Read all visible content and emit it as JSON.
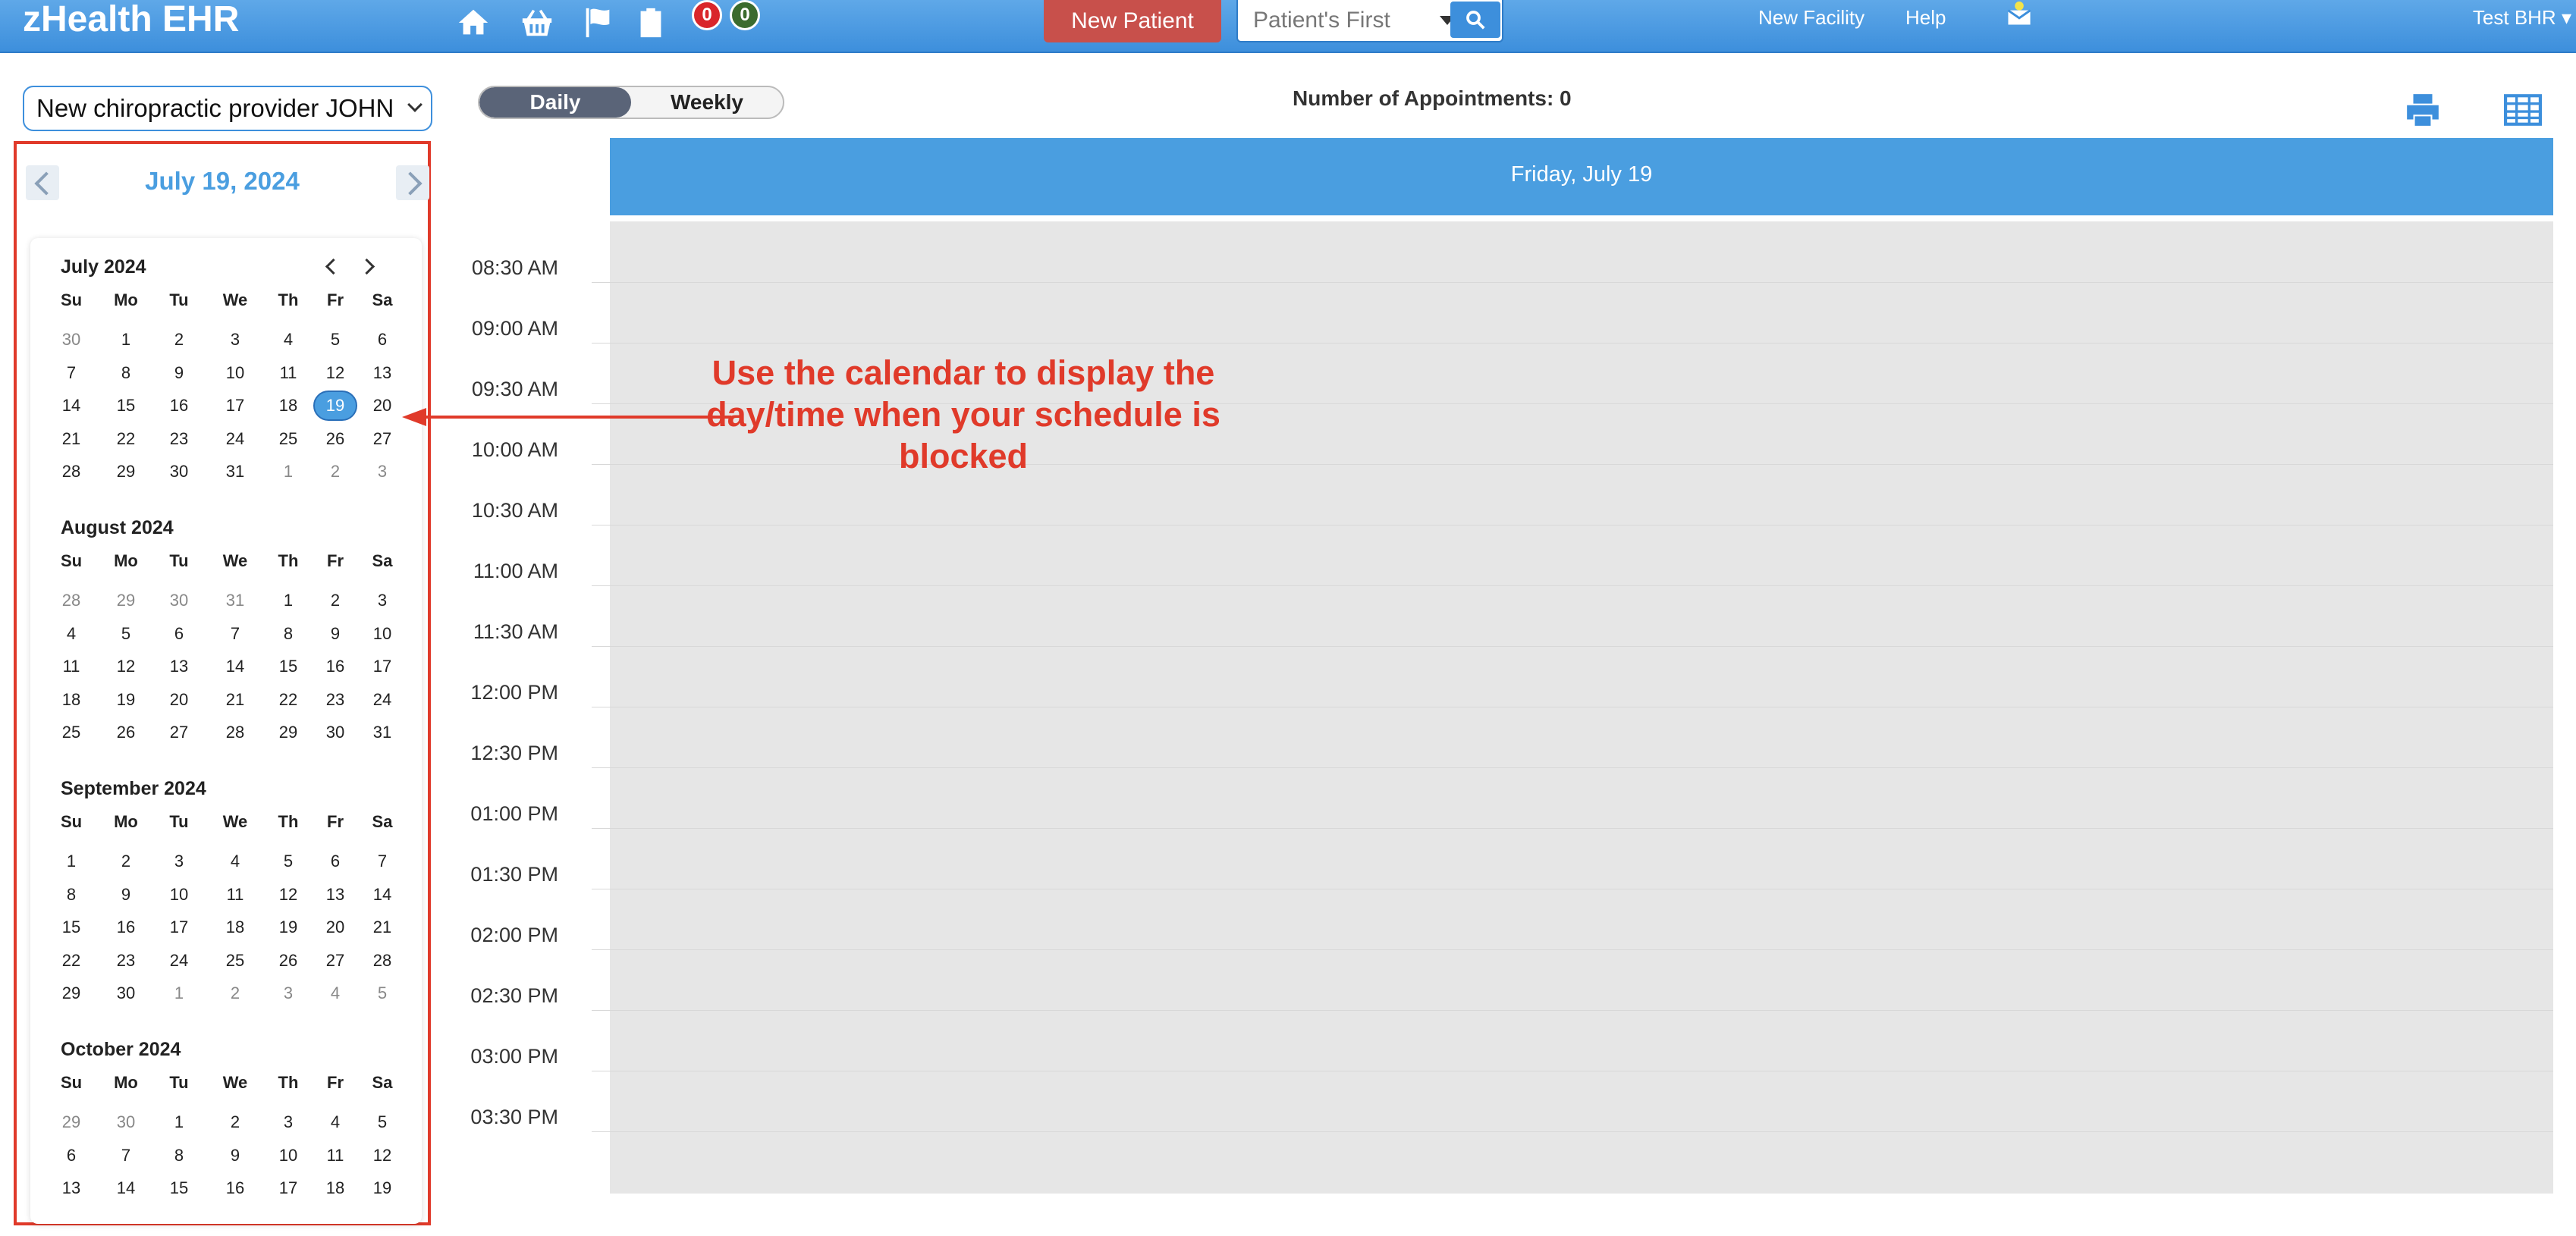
{
  "topbar": {
    "brand": "zHealth EHR",
    "badges": [
      {
        "count": "0",
        "color": "#d9262b"
      },
      {
        "count": "0",
        "color": "#3b6b2e"
      }
    ],
    "new_patient_label": "New Patient",
    "search_placeholder": "Patient's First",
    "links": {
      "new_facility": "New Facility",
      "help": "Help"
    },
    "user": "Test BHR"
  },
  "provider": {
    "selected": "New chiropractic provider JOHN SMITH"
  },
  "calendar": {
    "current_date": "July 19, 2024",
    "weekday_headers": [
      "Su",
      "Mo",
      "Tu",
      "We",
      "Th",
      "Fr",
      "Sa"
    ],
    "months": [
      {
        "title": "July 2024",
        "weeks": [
          [
            {
              "d": "30",
              "o": true
            },
            {
              "d": "1"
            },
            {
              "d": "2"
            },
            {
              "d": "3"
            },
            {
              "d": "4"
            },
            {
              "d": "5"
            },
            {
              "d": "6"
            }
          ],
          [
            {
              "d": "7"
            },
            {
              "d": "8"
            },
            {
              "d": "9"
            },
            {
              "d": "10"
            },
            {
              "d": "11"
            },
            {
              "d": "12"
            },
            {
              "d": "13"
            }
          ],
          [
            {
              "d": "14"
            },
            {
              "d": "15"
            },
            {
              "d": "16"
            },
            {
              "d": "17"
            },
            {
              "d": "18"
            },
            {
              "d": "19",
              "s": true
            },
            {
              "d": "20"
            }
          ],
          [
            {
              "d": "21"
            },
            {
              "d": "22"
            },
            {
              "d": "23"
            },
            {
              "d": "24"
            },
            {
              "d": "25"
            },
            {
              "d": "26"
            },
            {
              "d": "27"
            }
          ],
          [
            {
              "d": "28"
            },
            {
              "d": "29"
            },
            {
              "d": "30"
            },
            {
              "d": "31"
            },
            {
              "d": "1",
              "o": true
            },
            {
              "d": "2",
              "o": true
            },
            {
              "d": "3",
              "o": true
            }
          ]
        ]
      },
      {
        "title": "August 2024",
        "weeks": [
          [
            {
              "d": "28",
              "o": true
            },
            {
              "d": "29",
              "o": true
            },
            {
              "d": "30",
              "o": true
            },
            {
              "d": "31",
              "o": true
            },
            {
              "d": "1"
            },
            {
              "d": "2"
            },
            {
              "d": "3"
            }
          ],
          [
            {
              "d": "4"
            },
            {
              "d": "5"
            },
            {
              "d": "6"
            },
            {
              "d": "7"
            },
            {
              "d": "8"
            },
            {
              "d": "9"
            },
            {
              "d": "10"
            }
          ],
          [
            {
              "d": "11"
            },
            {
              "d": "12"
            },
            {
              "d": "13"
            },
            {
              "d": "14"
            },
            {
              "d": "15"
            },
            {
              "d": "16"
            },
            {
              "d": "17"
            }
          ],
          [
            {
              "d": "18"
            },
            {
              "d": "19"
            },
            {
              "d": "20"
            },
            {
              "d": "21"
            },
            {
              "d": "22"
            },
            {
              "d": "23"
            },
            {
              "d": "24"
            }
          ],
          [
            {
              "d": "25"
            },
            {
              "d": "26"
            },
            {
              "d": "27"
            },
            {
              "d": "28"
            },
            {
              "d": "29"
            },
            {
              "d": "30"
            },
            {
              "d": "31"
            }
          ]
        ]
      },
      {
        "title": "September 2024",
        "weeks": [
          [
            {
              "d": "1"
            },
            {
              "d": "2"
            },
            {
              "d": "3"
            },
            {
              "d": "4"
            },
            {
              "d": "5"
            },
            {
              "d": "6"
            },
            {
              "d": "7"
            }
          ],
          [
            {
              "d": "8"
            },
            {
              "d": "9"
            },
            {
              "d": "10"
            },
            {
              "d": "11"
            },
            {
              "d": "12"
            },
            {
              "d": "13"
            },
            {
              "d": "14"
            }
          ],
          [
            {
              "d": "15"
            },
            {
              "d": "16"
            },
            {
              "d": "17"
            },
            {
              "d": "18"
            },
            {
              "d": "19"
            },
            {
              "d": "20"
            },
            {
              "d": "21"
            }
          ],
          [
            {
              "d": "22"
            },
            {
              "d": "23"
            },
            {
              "d": "24"
            },
            {
              "d": "25"
            },
            {
              "d": "26"
            },
            {
              "d": "27"
            },
            {
              "d": "28"
            }
          ],
          [
            {
              "d": "29"
            },
            {
              "d": "30"
            },
            {
              "d": "1",
              "o": true
            },
            {
              "d": "2",
              "o": true
            },
            {
              "d": "3",
              "o": true
            },
            {
              "d": "4",
              "o": true
            },
            {
              "d": "5",
              "o": true
            }
          ]
        ]
      },
      {
        "title": "October 2024",
        "weeks": [
          [
            {
              "d": "29",
              "o": true
            },
            {
              "d": "30",
              "o": true
            },
            {
              "d": "1"
            },
            {
              "d": "2"
            },
            {
              "d": "3"
            },
            {
              "d": "4"
            },
            {
              "d": "5"
            }
          ],
          [
            {
              "d": "6"
            },
            {
              "d": "7"
            },
            {
              "d": "8"
            },
            {
              "d": "9"
            },
            {
              "d": "10"
            },
            {
              "d": "11"
            },
            {
              "d": "12"
            }
          ],
          [
            {
              "d": "13"
            },
            {
              "d": "14"
            },
            {
              "d": "15"
            },
            {
              "d": "16"
            },
            {
              "d": "17"
            },
            {
              "d": "18"
            },
            {
              "d": "19"
            }
          ]
        ]
      }
    ]
  },
  "view": {
    "daily_label": "Daily",
    "weekly_label": "Weekly",
    "active": "Daily"
  },
  "appointments": {
    "label": "Number of Appointments: 0"
  },
  "schedule": {
    "day_header": "Friday, July 19",
    "time_slots": [
      "08:30 AM",
      "09:00 AM",
      "09:30 AM",
      "10:00 AM",
      "10:30 AM",
      "11:00 AM",
      "11:30 AM",
      "12:00 PM",
      "12:30 PM",
      "01:00 PM",
      "01:30 PM",
      "02:00 PM",
      "02:30 PM",
      "03:00 PM",
      "03:30 PM"
    ]
  },
  "annotation": {
    "text": "Use the calendar to display the day/time when your schedule is blocked"
  },
  "colors": {
    "accent": "#4a9ee0",
    "annotation": "#e03a2a",
    "new_patient": "#c8504b"
  }
}
